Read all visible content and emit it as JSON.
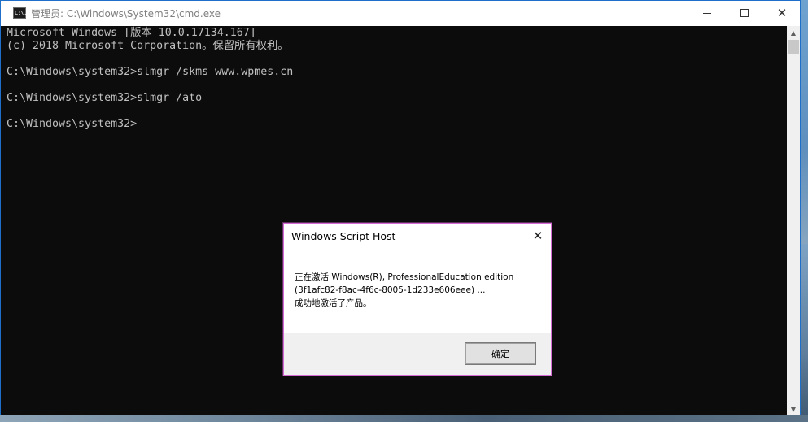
{
  "window": {
    "title": "管理员: C:\\Windows\\System32\\cmd.exe",
    "icon": "cmd-icon",
    "icon_text": "C:\\.",
    "controls": {
      "minimize_icon": "minimize-icon",
      "maximize_icon": "maximize-icon",
      "close_icon": "close-icon",
      "close_glyph": "✕"
    }
  },
  "console": {
    "lines": [
      "Microsoft Windows [版本 10.0.17134.167]",
      "(c) 2018 Microsoft Corporation。保留所有权利。",
      "",
      "C:\\Windows\\system32>slmgr /skms www.wpmes.cn",
      "",
      "C:\\Windows\\system32>slmgr /ato",
      "",
      "C:\\Windows\\system32>"
    ],
    "text_color": "#c0c0c0",
    "background": "#0c0c0c"
  },
  "scrollbar": {
    "up_glyph": "▲",
    "down_glyph": "▼"
  },
  "dialog": {
    "title": "Windows Script Host",
    "close_glyph": "✕",
    "message_lines": [
      "正在激活 Windows(R), ProfessionalEducation edition",
      "(3f1afc82-f8ac-4f6c-8005-1d233e606eee) ...",
      "成功地激活了产品。"
    ],
    "ok_label": "确定",
    "border_color": "#d46ad4"
  }
}
